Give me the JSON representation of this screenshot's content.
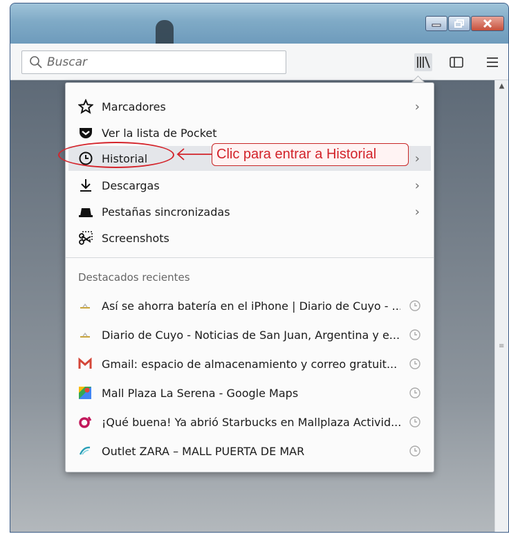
{
  "search": {
    "placeholder": "Buscar"
  },
  "menu": {
    "items": [
      {
        "label": "Marcadores",
        "icon": "star-icon",
        "submenu": true
      },
      {
        "label": "Ver la lista de Pocket",
        "icon": "pocket-icon",
        "submenu": false
      },
      {
        "label": "Historial",
        "icon": "clock-icon",
        "submenu": true,
        "highlighted": true
      },
      {
        "label": "Descargas",
        "icon": "download-icon",
        "submenu": true
      },
      {
        "label": "Pestañas sincronizadas",
        "icon": "synced-tabs-icon",
        "submenu": true
      },
      {
        "label": "Screenshots",
        "icon": "scissors-icon",
        "submenu": false
      }
    ],
    "recent_header": "Destacados recientes",
    "recent": [
      {
        "label": "Así se ahorra batería en el iPhone | Diario de Cuyo - ...",
        "icon": "diario-favicon"
      },
      {
        "label": "Diario de Cuyo - Noticias de San Juan, Argentina y e...",
        "icon": "diario-favicon"
      },
      {
        "label": "Gmail: espacio de almacenamiento y correo gratuit...",
        "icon": "gmail-favicon"
      },
      {
        "label": "Mall Plaza La Serena - Google Maps",
        "icon": "maps-favicon"
      },
      {
        "label": "¡Qué buena! Ya abrió Starbucks en Mallplaza Activid...",
        "icon": "mallplaza-favicon"
      },
      {
        "label": "Outlet ZARA – MALL PUERTA DE MAR",
        "icon": "mall-favicon"
      }
    ]
  },
  "annotation": {
    "text": "Clic para entrar a Historial"
  },
  "colors": {
    "annotation_red": "#d2232a",
    "menu_bg": "#fbfbfb",
    "highlight": "#e4e6ea"
  }
}
